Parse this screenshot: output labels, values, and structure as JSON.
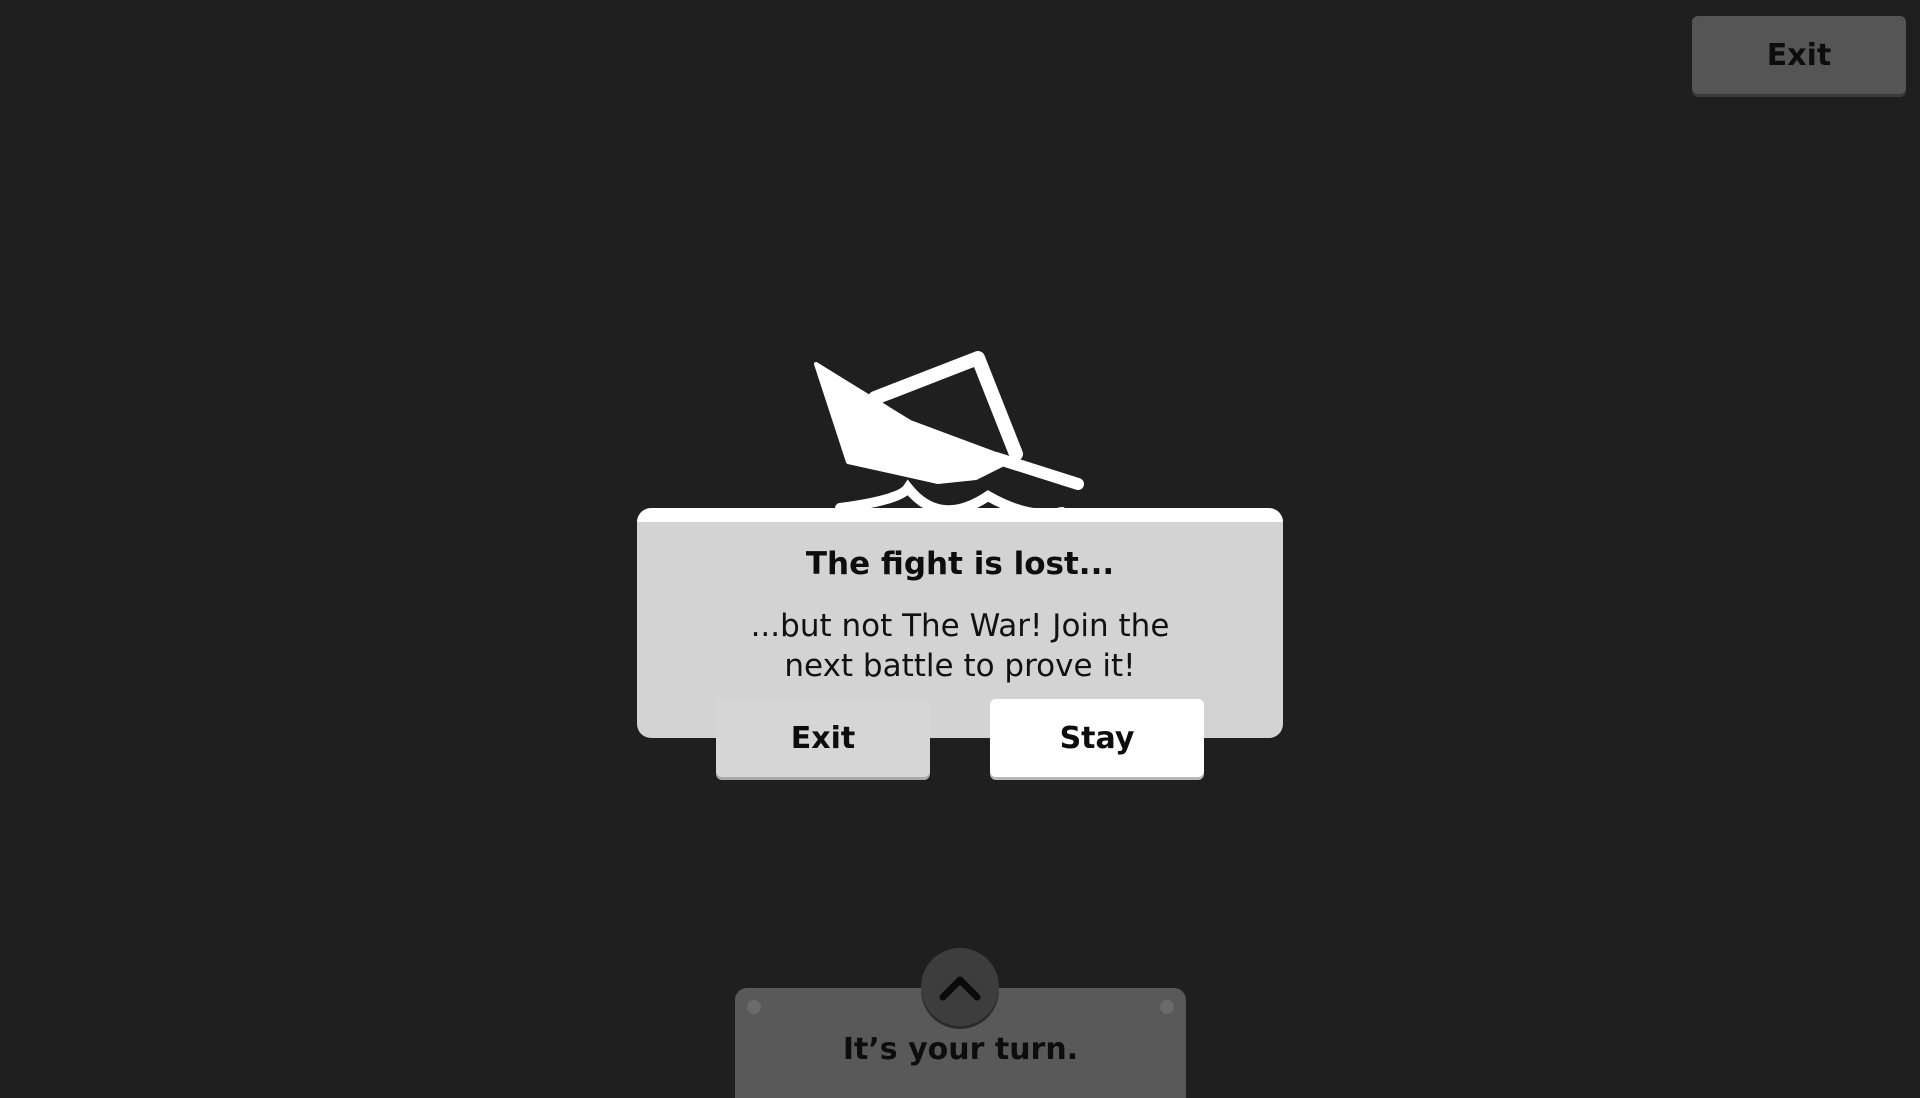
{
  "header": {
    "exit_label": "Exit"
  },
  "dialog": {
    "icon": "sinking-ship-icon",
    "title": "The fight is lost...",
    "body": "...but not The War! Join the next battle to prove it!",
    "exit_label": "Exit",
    "stay_label": "Stay"
  },
  "turn_panel": {
    "toggle_icon": "chevron-up-icon",
    "message": "It’s your turn."
  },
  "colors": {
    "background": "#1f1f1f",
    "dialog": "#d3d3d3",
    "panel": "#595959",
    "accent": "#ffffff"
  }
}
